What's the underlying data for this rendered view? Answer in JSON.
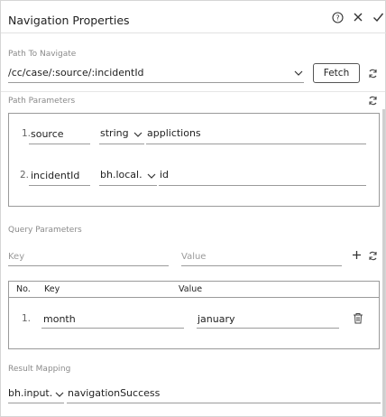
{
  "header": {
    "title": "Navigation Properties"
  },
  "path": {
    "label": "Path To Navigate",
    "value": "/cc/case/:source/:incidentId",
    "fetch_label": "Fetch"
  },
  "path_params": {
    "label": "Path Parameters",
    "rows": [
      {
        "index": "1.",
        "name": "source",
        "type": "string",
        "value": "applictions"
      },
      {
        "index": "2.",
        "name": "incidentId",
        "type": "bh.local.",
        "value": "id"
      }
    ]
  },
  "query_params": {
    "label": "Query Parameters",
    "key_placeholder": "Key",
    "value_placeholder": "Value",
    "table": {
      "col_no": "No.",
      "col_key": "Key",
      "col_value": "Value",
      "rows": [
        {
          "index": "1.",
          "key": "month",
          "value": "january"
        }
      ]
    }
  },
  "result_mapping": {
    "label": "Result Mapping",
    "scope": "bh.input.",
    "value": "navigationSuccess"
  },
  "icons": {
    "help": "help-circle-icon",
    "close": "close-icon",
    "confirm": "check-icon",
    "refresh": "refresh-icon",
    "add": "plus-icon",
    "delete": "trash-icon",
    "dropdown": "chevron-down-icon"
  }
}
